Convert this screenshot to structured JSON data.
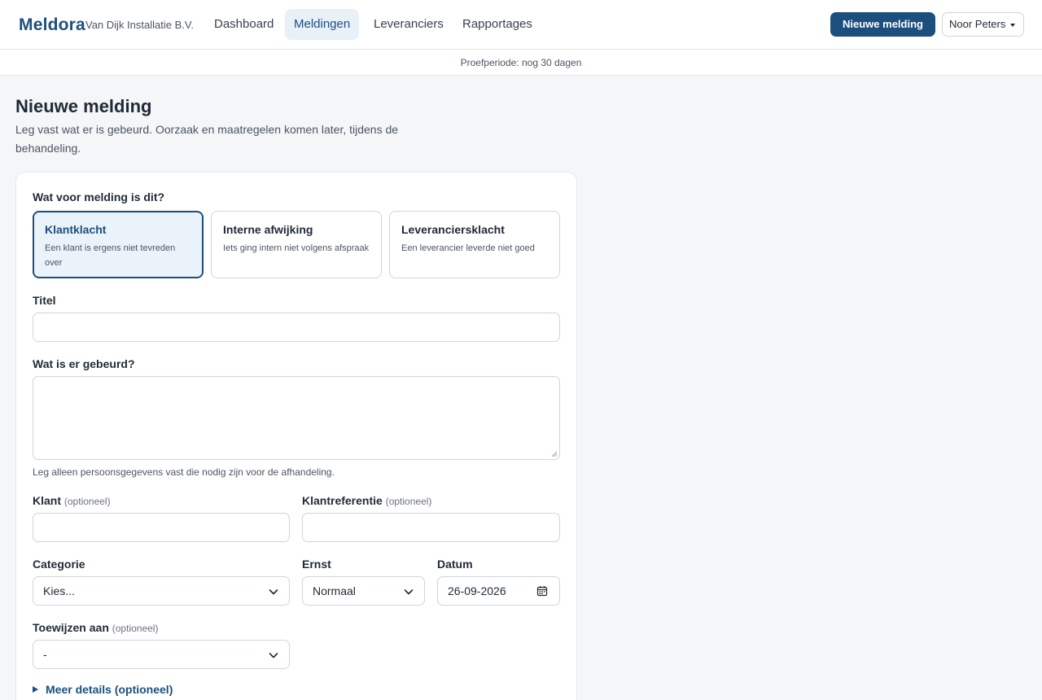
{
  "header": {
    "brand": "Meldora",
    "org": "Van Dijk Installatie B.V.",
    "nav": [
      {
        "label": "Dashboard"
      },
      {
        "label": "Meldingen"
      },
      {
        "label": "Leveranciers"
      },
      {
        "label": "Rapportages"
      }
    ],
    "new_button": "Nieuwe melding",
    "user": "Noor Peters",
    "accent": "#1d4f7e"
  },
  "trial": "Proefperiode: nog 30 dagen",
  "page": {
    "title": "Nieuwe melding",
    "subtitle": "Leg vast wat er is gebeurd. Oorzaak en maatregelen komen later, tijdens de behandeling."
  },
  "form": {
    "type_question": "Wat voor melding is dit?",
    "types": [
      {
        "title": "Klantklacht",
        "desc": "Een klant is ergens niet tevreden over",
        "selected": true
      },
      {
        "title": "Interne afwijking",
        "desc": "Iets ging intern niet volgens afspraak",
        "selected": false
      },
      {
        "title": "Leveranciersklacht",
        "desc": "Een leverancier leverde niet goed",
        "selected": false
      }
    ],
    "title_label": "Titel",
    "title_value": "",
    "what_label": "Wat is er gebeurd?",
    "what_value": "",
    "what_help": "Leg alleen persoonsgegevens vast die nodig zijn voor de afhandeling.",
    "klant_label": "Klant",
    "klantref_label": "Klantreferentie",
    "optional": "(optioneel)",
    "categorie_label": "Categorie",
    "categorie_value": "Kies...",
    "ernst_label": "Ernst",
    "ernst_value": "Normaal",
    "datum_label": "Datum",
    "datum_value": "26-09-2026",
    "assign_label": "Toewijzen aan",
    "assign_value": "-",
    "details_label": "Meer details (optioneel)"
  }
}
